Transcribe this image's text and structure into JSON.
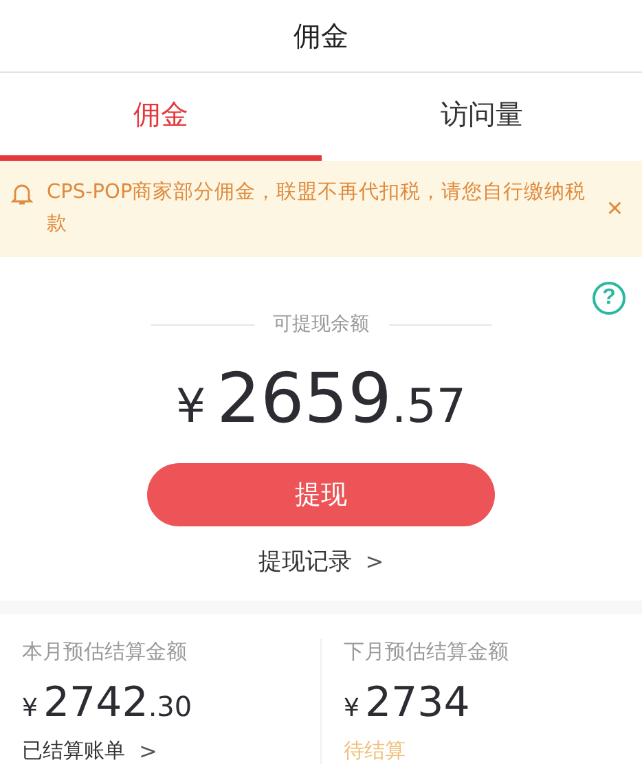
{
  "header": {
    "title": "佣金"
  },
  "tabs": [
    {
      "label": "佣金",
      "selected": true
    },
    {
      "label": "访问量",
      "selected": false
    }
  ],
  "notice": {
    "text": "CPS-POP商家部分佣金，联盟不再代扣税，请您自行缴纳税款",
    "close": "×"
  },
  "balance": {
    "help": "?",
    "label": "可提现余额",
    "currency": "¥",
    "integer": "2659",
    "decimal": ".57",
    "button": "提现",
    "record_link": "提现记录",
    "record_arrow": ">"
  },
  "estimates": [
    {
      "label": "本月预估结算金额",
      "currency": "¥",
      "integer": "2742",
      "decimal": ".30",
      "link": "已结算账单",
      "arrow": ">",
      "kind": "link"
    },
    {
      "label": "下月预估结算金额",
      "currency": "¥",
      "integer": "2734",
      "link": "待结算",
      "kind": "pending"
    }
  ]
}
